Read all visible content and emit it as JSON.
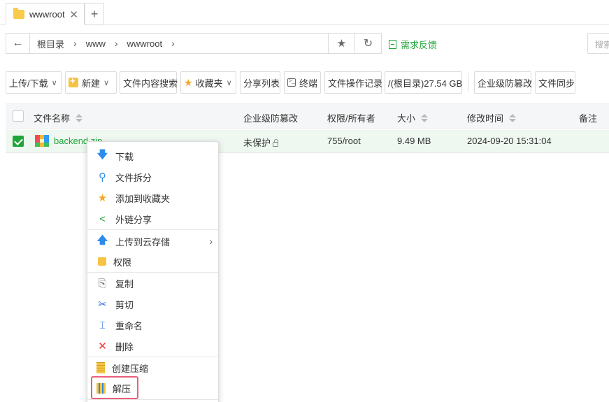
{
  "tabs": [
    {
      "label": "wwwroot",
      "close": "✕"
    }
  ],
  "tab_add": "+",
  "address": {
    "crumbs": [
      "根目录",
      "www",
      "wwwroot"
    ],
    "separator": "›"
  },
  "feedback": "需求反馈",
  "search_placeholder": "搜索",
  "toolbar": {
    "upload": "上传/下载",
    "new": "新建",
    "content_search": "文件内容搜索",
    "favorites": "收藏夹",
    "share_list": "分享列表",
    "terminal": "终端",
    "op_log": "文件操作记录",
    "disk": "/(根目录)27.54 GB",
    "tamper": "企业级防篡改",
    "sync": "文件同步"
  },
  "table": {
    "headers": {
      "name": "文件名称",
      "tamper": "企业级防篡改",
      "perm": "权限/所有者",
      "size": "大小",
      "mtime": "修改时间",
      "note": "备注"
    },
    "rows": [
      {
        "name": "backend.zip",
        "tamper": "未保护",
        "perm": "755/root",
        "size": "9.49 MB",
        "mtime": "2024-09-20 15:31:04",
        "checked": true
      }
    ]
  },
  "context_menu": {
    "items": [
      {
        "label": "下载",
        "icon": "download-icon"
      },
      {
        "label": "文件拆分",
        "icon": "split-icon"
      },
      {
        "label": "添加到收藏夹",
        "icon": "star-icon"
      },
      {
        "label": "外链分享",
        "icon": "share-icon"
      },
      {
        "label": "上传到云存储",
        "icon": "cloud-upload-icon",
        "has_submenu": true
      },
      {
        "label": "权限",
        "icon": "permission-icon"
      },
      {
        "label": "复制",
        "icon": "copy-icon"
      },
      {
        "label": "剪切",
        "icon": "cut-icon"
      },
      {
        "label": "重命名",
        "icon": "rename-icon"
      },
      {
        "label": "删除",
        "icon": "delete-icon"
      },
      {
        "label": "创建压缩",
        "icon": "compress-icon"
      },
      {
        "label": "解压",
        "icon": "extract-icon",
        "highlighted": true
      }
    ]
  },
  "colors": {
    "accent": "#20a53a",
    "highlight_border": "#ea5e79"
  }
}
